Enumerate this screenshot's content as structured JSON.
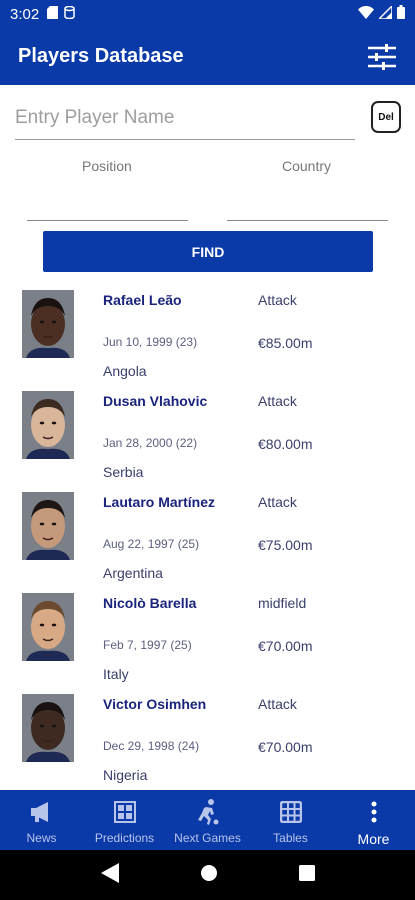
{
  "status_bar": {
    "time": "3:02"
  },
  "app_bar": {
    "title": "Players Database"
  },
  "search": {
    "placeholder": "Entry Player Name",
    "value": "",
    "del_label": "Del"
  },
  "filters": {
    "position_label": "Position",
    "country_label": "Country"
  },
  "find_label": "FIND",
  "players": [
    {
      "name": "Rafael Leão",
      "position": "Attack",
      "dob": "Jun 10, 1999 (23)",
      "value": "€85.00m",
      "country": "Angola",
      "skin": "#4a2f22",
      "hair": "#1a1210"
    },
    {
      "name": "Dusan Vlahovic",
      "position": "Attack",
      "dob": "Jan 28, 2000 (22)",
      "value": "€80.00m",
      "country": "Serbia",
      "skin": "#d9b59a",
      "hair": "#3a2a20"
    },
    {
      "name": "Lautaro Martínez",
      "position": "Attack",
      "dob": "Aug 22, 1997 (25)",
      "value": "€75.00m",
      "country": "Argentina",
      "skin": "#c59a7c",
      "hair": "#1e1612"
    },
    {
      "name": "Nicolò Barella",
      "position": "midfield",
      "dob": "Feb 7, 1997 (25)",
      "value": "€70.00m",
      "country": "Italy",
      "skin": "#d8a985",
      "hair": "#6b4a30"
    },
    {
      "name": "Victor Osimhen",
      "position": "Attack",
      "dob": "Dec 29, 1998 (24)",
      "value": "€70.00m",
      "country": "Nigeria",
      "skin": "#3e2a20",
      "hair": "#1a1210"
    }
  ],
  "bottom_nav": [
    {
      "label": "News",
      "icon": "megaphone-icon"
    },
    {
      "label": "Predictions",
      "icon": "grid-icon"
    },
    {
      "label": "Next Games",
      "icon": "runner-icon"
    },
    {
      "label": "Tables",
      "icon": "table-icon"
    },
    {
      "label": "More",
      "icon": "more-vertical-icon",
      "active": true
    }
  ],
  "colors": {
    "primary": "#0a3aa8",
    "text_dark": "#1a237e"
  }
}
